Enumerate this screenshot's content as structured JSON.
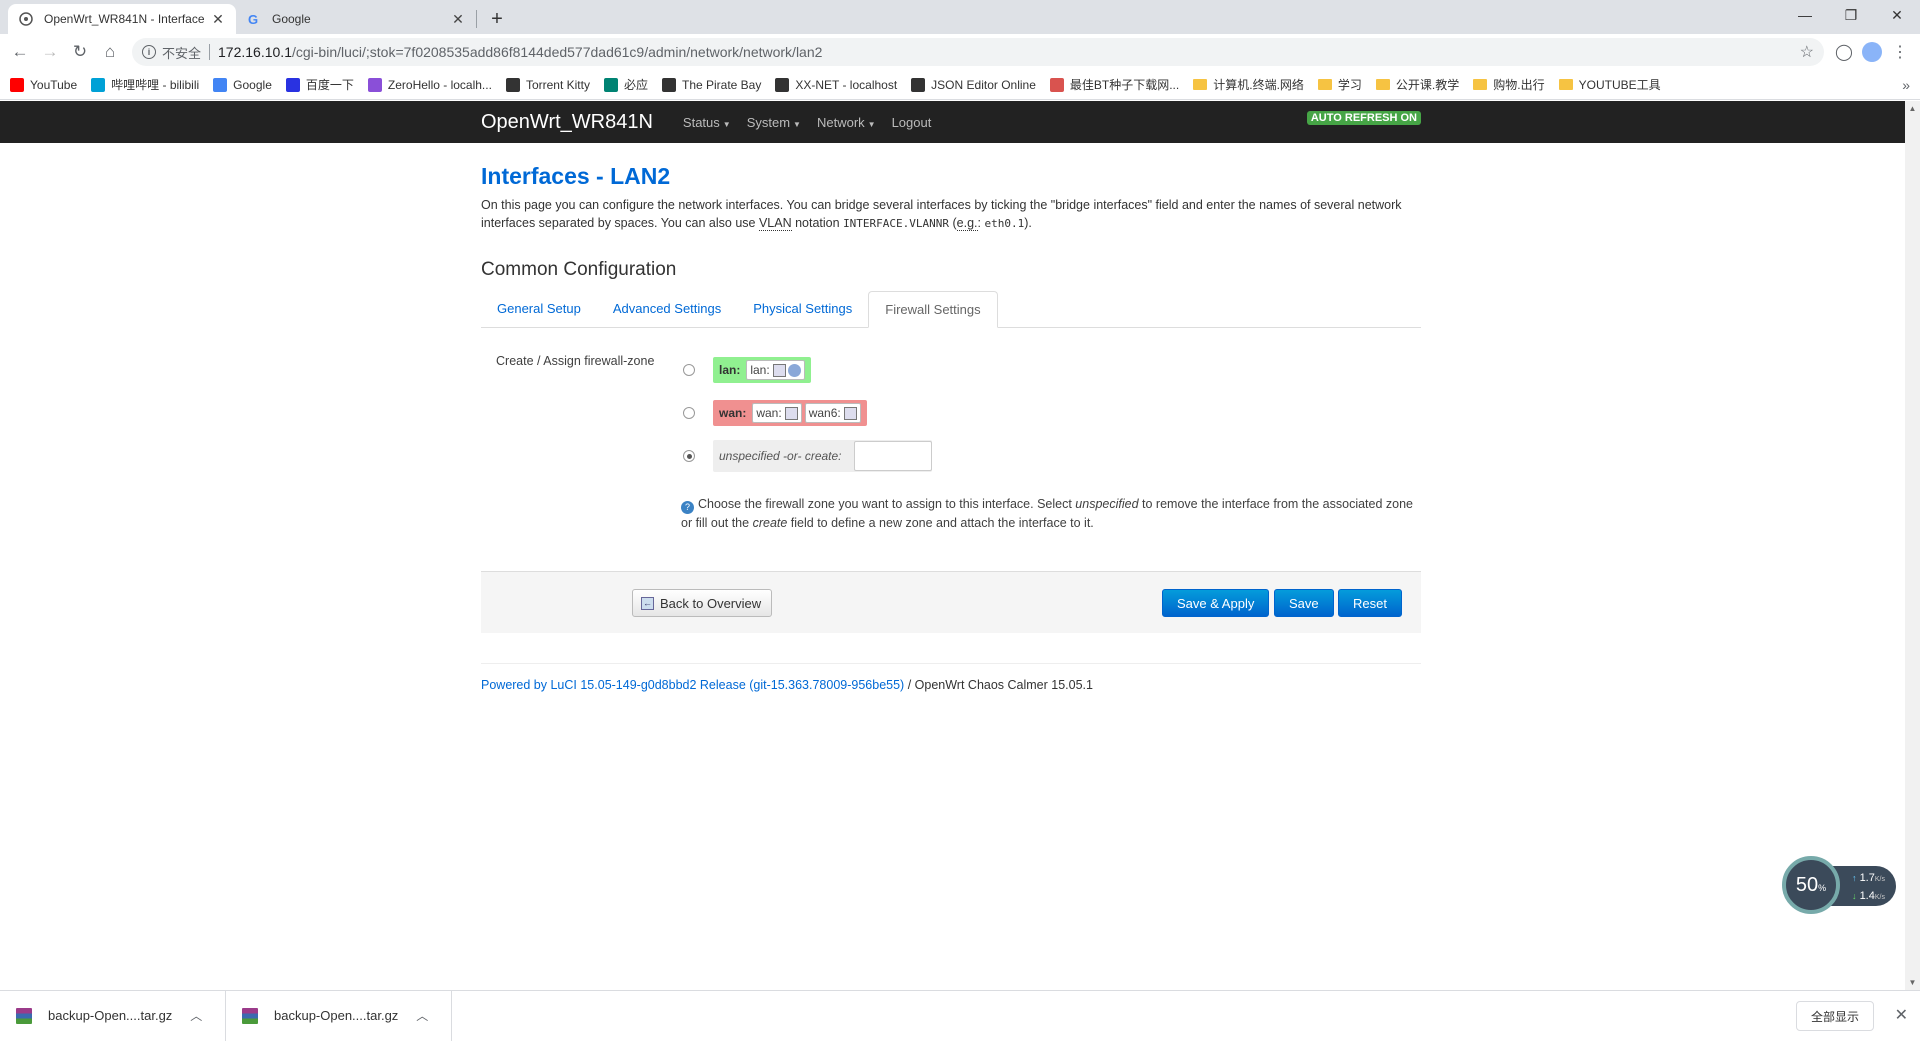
{
  "browser": {
    "tabs": [
      {
        "title": "OpenWrt_WR841N - Interface",
        "active": true
      },
      {
        "title": "Google",
        "active": false
      }
    ],
    "new_tab": "+",
    "window_controls": {
      "minimize": "—",
      "restore": "❐",
      "close": "✕"
    },
    "address": {
      "insecure_label": "不安全",
      "host": "172.16.10.1",
      "path": "/cgi-bin/luci/;stok=7f0208535add86f8144ded577dad61c9/admin/network/network/lan2"
    },
    "bookmarks": [
      {
        "label": "YouTube",
        "icon": "youtube-icon",
        "color": "#ff0000"
      },
      {
        "label": "哔哩哔哩 - bilibili",
        "icon": "bilibili-icon",
        "color": "#00a1d6"
      },
      {
        "label": "Google",
        "icon": "google-icon",
        "color": "#4285f4"
      },
      {
        "label": "百度一下",
        "icon": "baidu-icon",
        "color": "#2932e1"
      },
      {
        "label": "ZeroHello - localh...",
        "icon": "zeronet-icon",
        "color": "#8a4fd8"
      },
      {
        "label": "Torrent Kitty",
        "icon": "kitty-icon",
        "color": "#333333"
      },
      {
        "label": "必应",
        "icon": "bing-icon",
        "color": "#008373"
      },
      {
        "label": "The Pirate Bay",
        "icon": "pirate-ship-icon",
        "color": "#333333"
      },
      {
        "label": "XX-NET - localhost",
        "icon": "xxnet-icon",
        "color": "#333333"
      },
      {
        "label": "JSON Editor Online",
        "icon": "json-icon",
        "color": "#333333"
      },
      {
        "label": "最佳BT种子下载网...",
        "icon": "bt-icon",
        "color": "#d9534f"
      },
      {
        "label": "计算机.终端.网络",
        "icon": "folder-icon",
        "color": "#f6c342"
      },
      {
        "label": "学习",
        "icon": "folder-icon",
        "color": "#f6c342"
      },
      {
        "label": "公开课.教学",
        "icon": "folder-icon",
        "color": "#f6c342"
      },
      {
        "label": "购物.出行",
        "icon": "folder-icon",
        "color": "#f6c342"
      },
      {
        "label": "YOUTUBE工具",
        "icon": "folder-icon",
        "color": "#f6c342"
      }
    ],
    "bookmarks_more": "»"
  },
  "router": {
    "brand": "OpenWrt_WR841N",
    "menu": [
      "Status",
      "System",
      "Network",
      "Logout"
    ],
    "auto_refresh": "AUTO REFRESH ON"
  },
  "page": {
    "title": "Interfaces - LAN2",
    "desc_part1": "On this page you can configure the network interfaces. You can bridge several interfaces by ticking the \"bridge interfaces\" field and enter the names of several network interfaces separated by spaces. You can also use ",
    "desc_vlan": "VLAN",
    "desc_part2": " notation ",
    "desc_code1": "INTERFACE.VLANNR",
    "desc_part3": " (",
    "desc_eg": "e.g.",
    "desc_part4": ": ",
    "desc_code2": "eth0.1",
    "desc_part5": ").",
    "section_title": "Common Configuration",
    "tabs": [
      "General Setup",
      "Advanced Settings",
      "Physical Settings",
      "Firewall Settings"
    ],
    "selected_tab": "Firewall Settings",
    "field_label": "Create / Assign firewall-zone",
    "zones": {
      "lan": {
        "name": "lan:",
        "chips": [
          "lan:"
        ],
        "color": "#90f090"
      },
      "wan": {
        "name": "wan:",
        "chips": [
          "wan:",
          "wan6:"
        ],
        "color": "#f09090"
      },
      "unspecified": {
        "label": "unspecified -or- create:",
        "value": ""
      }
    },
    "selected_zone": "unspecified",
    "help_part1": "Choose the firewall zone you want to assign to this interface. Select ",
    "help_em1": "unspecified",
    "help_part2": " to remove the interface from the associated zone or fill out the ",
    "help_em2": "create",
    "help_part3": " field to define a new zone and attach the interface to it.",
    "buttons": {
      "back": "Back to Overview",
      "save_apply": "Save & Apply",
      "save": "Save",
      "reset": "Reset"
    },
    "footer_link": "Powered by LuCI 15.05-149-g0d8bbd2 Release (git-15.363.78009-956be55)",
    "footer_rest": " / OpenWrt Chaos Calmer 15.05.1"
  },
  "speed_widget": {
    "percent": "50",
    "unit": "%",
    "up": "1.7",
    "down": "1.4",
    "rate_unit": "K/s"
  },
  "downloads": {
    "items": [
      "backup-Open....tar.gz",
      "backup-Open....tar.gz"
    ],
    "show_all": "全部显示",
    "close": "✕"
  }
}
